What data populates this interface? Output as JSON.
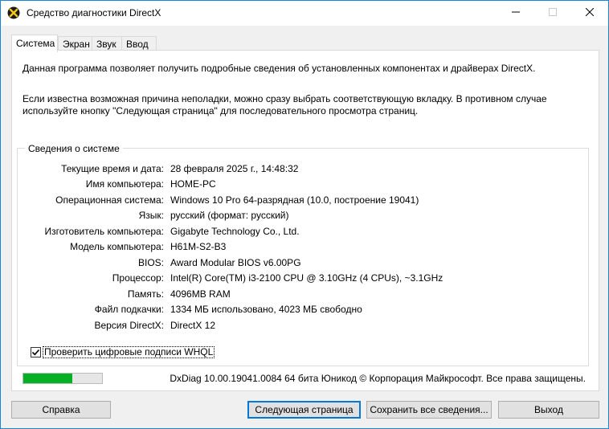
{
  "window": {
    "title": "Средство диагностики DirectX"
  },
  "tabs": [
    {
      "label": "Система",
      "active": true
    },
    {
      "label": "Экран",
      "active": false
    },
    {
      "label": "Звук",
      "active": false
    },
    {
      "label": "Ввод",
      "active": false
    }
  ],
  "intro": {
    "line1": "Данная программа позволяет получить подробные сведения об установленных компонентах и драйверах DirectX.",
    "line2": "Если известна возможная причина неполадки, можно сразу выбрать соответствующую вкладку. В противном случае используйте кнопку \"Следующая страница\" для последовательного просмотра страниц."
  },
  "system_info": {
    "group_label": "Сведения о системе",
    "rows": [
      {
        "label": "Текущие время и дата:",
        "value": "28 февраля 2025 г., 14:48:32"
      },
      {
        "label": "Имя компьютера:",
        "value": "HOME-PC"
      },
      {
        "label": "Операционная система:",
        "value": "Windows 10 Pro 64-разрядная (10.0, построение 19041)"
      },
      {
        "label": "Язык:",
        "value": "русский (формат: русский)"
      },
      {
        "label": "Изготовитель компьютера:",
        "value": "Gigabyte Technology Co., Ltd."
      },
      {
        "label": "Модель компьютера:",
        "value": "H61M-S2-B3"
      },
      {
        "label": "BIOS:",
        "value": "Award Modular BIOS v6.00PG"
      },
      {
        "label": "Процессор:",
        "value": "Intel(R) Core(TM) i3-2100 CPU @ 3.10GHz (4 CPUs), ~3.1GHz"
      },
      {
        "label": "Память:",
        "value": "4096MB RAM"
      },
      {
        "label": "Файл подкачки:",
        "value": "1334 МБ использовано, 4023 МБ свободно"
      },
      {
        "label": "Версия DirectX:",
        "value": "DirectX 12"
      }
    ]
  },
  "whql_checkbox": {
    "label": "Проверить цифровые подписи WHQL",
    "checked": true
  },
  "progress": {
    "fraction": 0.62,
    "color": "#06b025"
  },
  "footer": {
    "copyright": "DxDiag 10.00.19041.0084 64 бита Юникод © Корпорация Майкрософт. Все права защищены."
  },
  "buttons": {
    "help": "Справка",
    "next": "Следующая страница",
    "save": "Сохранить все сведения...",
    "exit": "Выход"
  },
  "colors": {
    "accent": "#0078d7",
    "window_border": "#1883d7"
  }
}
